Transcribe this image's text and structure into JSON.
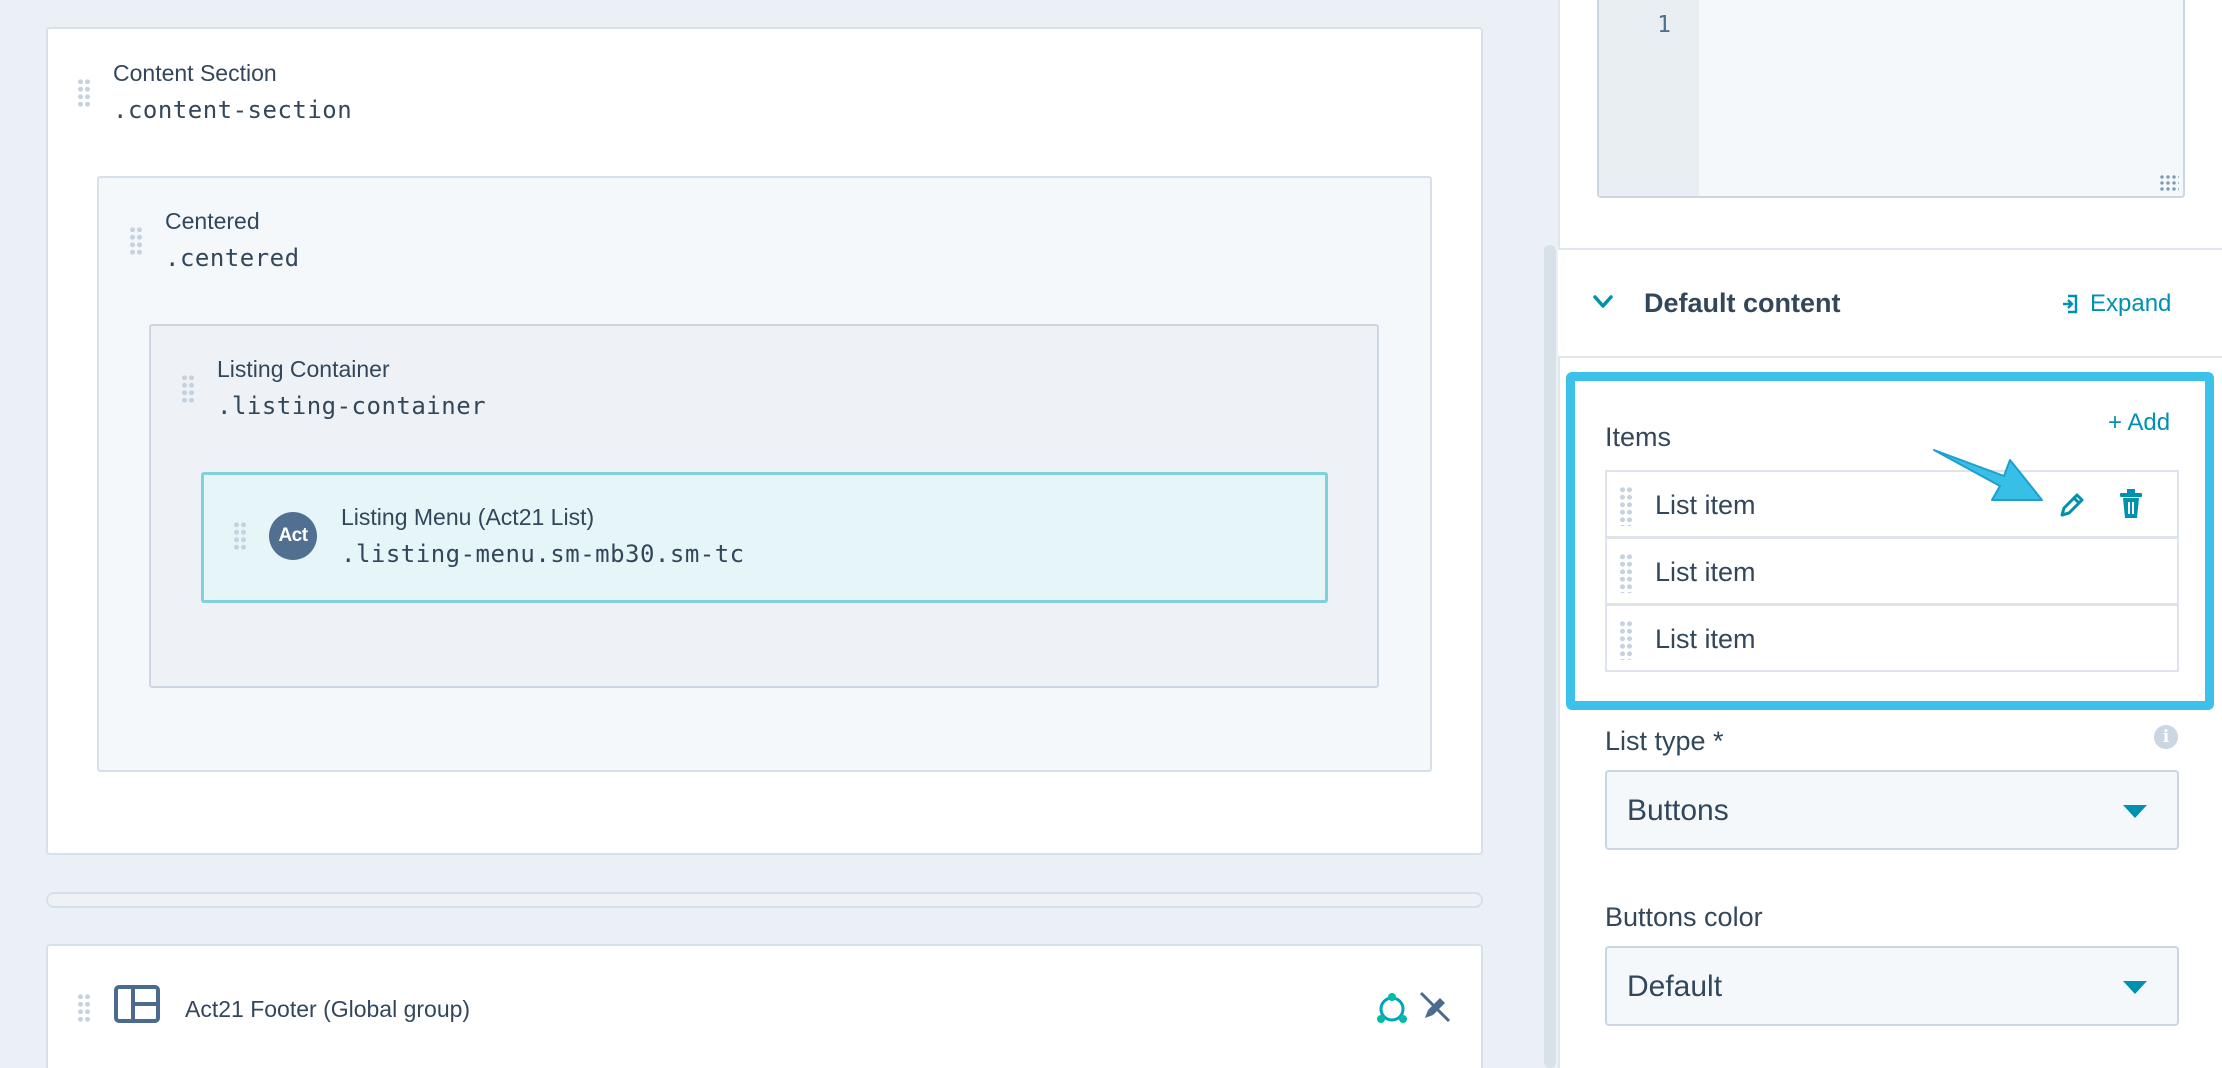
{
  "canvas": {
    "content_section": {
      "title": "Content Section",
      "class_name": ".content-section"
    },
    "centered": {
      "title": "Centered",
      "class_name": ".centered"
    },
    "listing_container": {
      "title": "Listing Container",
      "class_name": ".listing-container"
    },
    "listing_menu": {
      "title": "Listing Menu (Act21 List)",
      "class_name": ".listing-menu.sm-mb30.sm-tc",
      "avatar_text": "Act"
    },
    "footer": {
      "title": "Act21 Footer (Global group)"
    }
  },
  "sidebar": {
    "code_editor": {
      "line_number": "1"
    },
    "default_content": {
      "title": "Default content",
      "expand_label": "Expand"
    },
    "items": {
      "label": "Items",
      "add_label": "+ Add",
      "rows": [
        {
          "label": "List item"
        },
        {
          "label": "List item"
        },
        {
          "label": "List item"
        }
      ]
    },
    "list_type": {
      "label": "List type *",
      "value": "Buttons"
    },
    "buttons_color": {
      "label": "Buttons color",
      "value": "Default"
    }
  },
  "colors": {
    "highlight_border": "#3cc1ea",
    "accent": "#0091ae",
    "text": "#33475b",
    "selected_module_bg": "#e5f5f8",
    "selected_module_border": "#7fd1de",
    "arrow": "#38bfe8"
  },
  "icons": {
    "drag_handle": "drag-handle-icon",
    "layout": "layout-icon",
    "global": "global-group-icon",
    "edit": "pencil-icon",
    "delete": "trash-icon",
    "info": "info-icon",
    "collapse": "chevron-down-icon",
    "expand": "expand-icon"
  }
}
